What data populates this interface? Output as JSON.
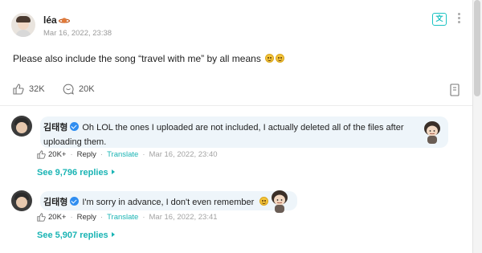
{
  "post": {
    "author": "léa",
    "author_emoji": "planet-emoji",
    "date": "Mar 16, 2022, 23:38",
    "body": "Please also include the song “travel with me” by all means",
    "emojis": [
      "smiling-emoji",
      "smiling-emoji"
    ],
    "likes": "32K",
    "comments": "20K"
  },
  "comments": [
    {
      "author": "김태형",
      "verified": true,
      "text_line1": "Oh LOL the ones I uploaded are not included, I actually deleted all of the files after",
      "text_line2": "uploading them.",
      "likes": "20K+",
      "reply_label": "Reply",
      "translate_label": "Translate",
      "date": "Mar 16, 2022, 23:40",
      "see_replies": "See 9,796 replies"
    },
    {
      "author": "김태형",
      "verified": true,
      "text_line1": "I'm sorry in advance, I don't even remember",
      "likes": "20K+",
      "reply_label": "Reply",
      "translate_label": "Translate",
      "date": "Mar 16, 2022, 23:41",
      "see_replies": "See 5,907 replies"
    }
  ],
  "colors": {
    "accent": "#19b4b4",
    "verified": "#2f8df0",
    "bubble": "#eef5fa"
  }
}
